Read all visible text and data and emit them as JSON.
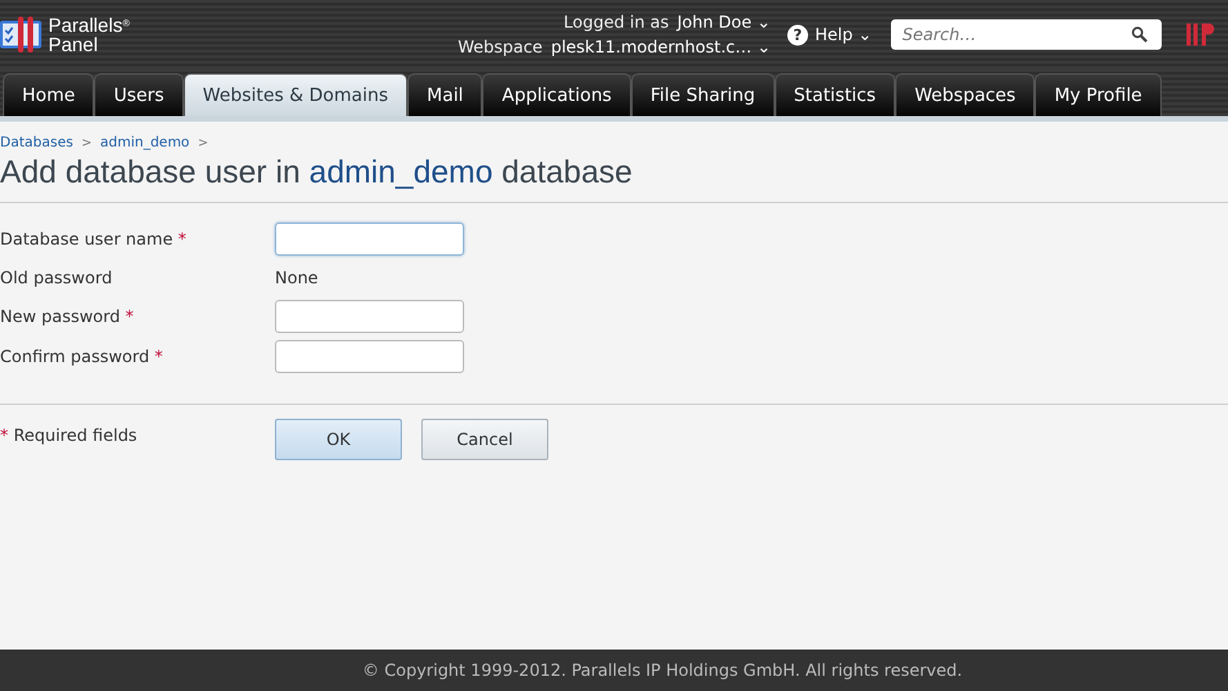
{
  "header": {
    "brand": {
      "line1": "Parallels",
      "reg": "®",
      "line2": "Panel"
    },
    "logged_in": {
      "label": "Logged in as",
      "user": "John Doe",
      "caret": "⌄"
    },
    "webspace": {
      "label": "Webspace",
      "value": "plesk11.modernhost.c…",
      "caret": "⌄"
    },
    "help": {
      "icon": "?",
      "label": "Help",
      "caret": "⌄"
    },
    "search": {
      "placeholder": "Search…"
    }
  },
  "tabs": [
    {
      "label": "Home",
      "selected": false
    },
    {
      "label": "Users",
      "selected": false
    },
    {
      "label": "Websites & Domains",
      "selected": true
    },
    {
      "label": "Mail",
      "selected": false
    },
    {
      "label": "Applications",
      "selected": false
    },
    {
      "label": "File Sharing",
      "selected": false
    },
    {
      "label": "Statistics",
      "selected": false
    },
    {
      "label": "Webspaces",
      "selected": false
    },
    {
      "label": "My Profile",
      "selected": false
    }
  ],
  "breadcrumbs": [
    {
      "label": "Databases",
      "sep": ">"
    },
    {
      "label": "admin_demo",
      "sep": ">"
    }
  ],
  "title": {
    "before": "Add database user in",
    "link": "admin_demo",
    "after": "database"
  },
  "fields": [
    {
      "kind": "input",
      "label": "Database user name",
      "required": true,
      "focused": true
    },
    {
      "kind": "static",
      "label": "Old password",
      "required": false,
      "value": "None"
    },
    {
      "kind": "input",
      "label": "New password",
      "required": true,
      "focused": false
    },
    {
      "kind": "input",
      "label": "Confirm password",
      "required": true,
      "focused": false
    }
  ],
  "required_note": {
    "mark": "*",
    "text": "Required fields"
  },
  "buttons": [
    {
      "label": "OK",
      "primary": true
    },
    {
      "label": "Cancel",
      "primary": false
    }
  ],
  "footer": {
    "copyright": "© Copyright 1999-2012. Parallels IP Holdings GmbH. All rights reserved."
  }
}
